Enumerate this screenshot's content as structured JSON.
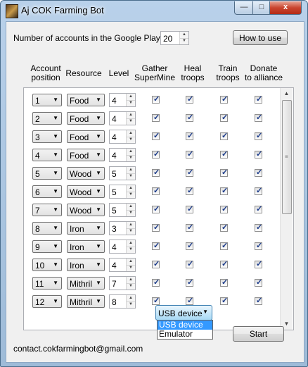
{
  "window": {
    "title": "Aj COK Farming Bot",
    "controls": {
      "minimize": "—",
      "maximize": "□",
      "close": "x"
    }
  },
  "top": {
    "accounts_label": "Number of accounts in the Google Play list:",
    "accounts_value": "20",
    "how_to_use": "How to use"
  },
  "headers": {
    "position": [
      "Account",
      "position"
    ],
    "resource": "Resource",
    "level": "Level",
    "gather": [
      "Gather",
      "SuperMine"
    ],
    "heal": [
      "Heal",
      "troops"
    ],
    "train": [
      "Train",
      "troops"
    ],
    "donate": [
      "Donate",
      "to alliance"
    ]
  },
  "rows": [
    {
      "position": "1",
      "resource": "Food",
      "level": "4",
      "gather": true,
      "heal": true,
      "train": true,
      "donate": true
    },
    {
      "position": "2",
      "resource": "Food",
      "level": "4",
      "gather": true,
      "heal": true,
      "train": true,
      "donate": true
    },
    {
      "position": "3",
      "resource": "Food",
      "level": "4",
      "gather": true,
      "heal": true,
      "train": true,
      "donate": true
    },
    {
      "position": "4",
      "resource": "Food",
      "level": "4",
      "gather": true,
      "heal": true,
      "train": true,
      "donate": true
    },
    {
      "position": "5",
      "resource": "Wood",
      "level": "5",
      "gather": true,
      "heal": true,
      "train": true,
      "donate": true
    },
    {
      "position": "6",
      "resource": "Wood",
      "level": "5",
      "gather": true,
      "heal": true,
      "train": true,
      "donate": true
    },
    {
      "position": "7",
      "resource": "Wood",
      "level": "5",
      "gather": true,
      "heal": true,
      "train": true,
      "donate": true
    },
    {
      "position": "8",
      "resource": "Iron",
      "level": "3",
      "gather": true,
      "heal": true,
      "train": true,
      "donate": true
    },
    {
      "position": "9",
      "resource": "Iron",
      "level": "4",
      "gather": true,
      "heal": true,
      "train": true,
      "donate": true
    },
    {
      "position": "10",
      "resource": "Iron",
      "level": "4",
      "gather": true,
      "heal": true,
      "train": true,
      "donate": true
    },
    {
      "position": "11",
      "resource": "Mithril",
      "level": "7",
      "gather": true,
      "heal": true,
      "train": true,
      "donate": true
    },
    {
      "position": "12",
      "resource": "Mithril",
      "level": "8",
      "gather": true,
      "heal": true,
      "train": true,
      "donate": true
    }
  ],
  "bottom": {
    "contact": "contact.cokfarmingbot@gmail.com",
    "device_selected": "USB device",
    "device_options": [
      "USB device",
      "Emulator"
    ],
    "start": "Start"
  },
  "colors": {
    "selection": "#3399ff",
    "close_button": "#c9452f",
    "title_bar": "#b9d1ea"
  }
}
